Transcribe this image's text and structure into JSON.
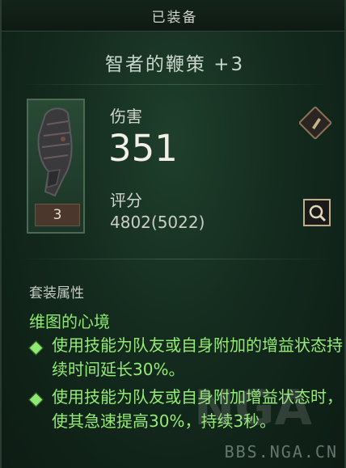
{
  "header": {
    "title": "已装备"
  },
  "item": {
    "name": "智者的鞭策 +3",
    "quantity": "3",
    "damage_label": "伤害",
    "damage_value": "351",
    "score_label": "评分",
    "score_value": "4802(5022)"
  },
  "set": {
    "section_title": "套装属性",
    "name": "维图的心境",
    "effects": [
      "使用技能为队友或自身附加的增益状态持续时间延长30%。",
      "使用技能为队友或自身附加增益状态时，使其急速提高30%，持续3秒。"
    ]
  },
  "watermark": {
    "text": "BBS.NGA.CN",
    "logo": "NGA"
  },
  "colors": {
    "set_green": "#8fe870",
    "panel_bg": "#1a3324"
  }
}
